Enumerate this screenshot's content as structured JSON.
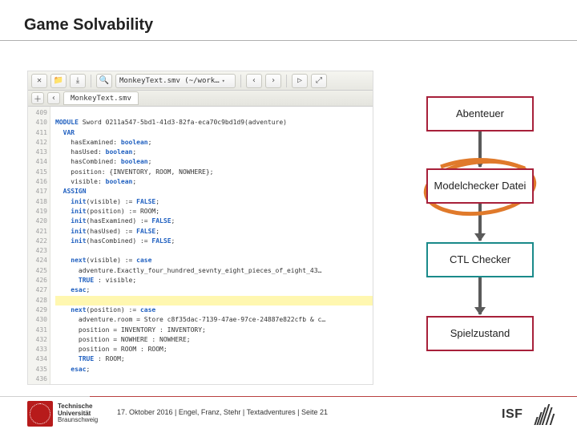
{
  "title": "Game Solvability",
  "editor": {
    "toolbar": {
      "dropdown1": "MonkeyText.smv (~/work…",
      "tab": "MonkeyText.smv"
    },
    "lines_start": 409,
    "lines_end": 436,
    "code": [
      "",
      "MODULE Sword 0211a547-5bd1-41d3-82fa-eca70c9bd1d9(adventure)",
      "  VAR",
      "    hasExamined: boolean;",
      "    hasUsed: boolean;",
      "    hasCombined: boolean;",
      "    position: {INVENTORY, ROOM, NOWHERE};",
      "    visible: boolean;",
      "  ASSIGN",
      "    init(visible) := FALSE;",
      "    init(position) := ROOM;",
      "    init(hasExamined) := FALSE;",
      "    init(hasUsed) := FALSE;",
      "    init(hasCombined) := FALSE;",
      "",
      "    next(visible) := case",
      "      adventure.Exactly_four_hundred_sevnty_eight_pieces_of_eight_43…",
      "      TRUE : visible;",
      "    esac;",
      "",
      "    next(position) := case",
      "      adventure.room = Store c8f35dac-7139-47ae-97ce-24887e822cfb & c…",
      "      position = INVENTORY : INVENTORY;",
      "      position = NOWHERE : NOWHERE;",
      "      position = ROOM : ROOM;",
      "      TRUE : ROOM;",
      "    esac;",
      ""
    ]
  },
  "flow": {
    "box1": "Abenteuer",
    "box2": "Modelchecker Datei",
    "box3": "CTL Checker",
    "box4": "Spielzustand"
  },
  "footer": {
    "text": "17. Oktober 2016 | Engel, Franz, Stehr | Textadventures | Seite 21",
    "tu_line1": "Technische",
    "tu_line2": "Universität",
    "tu_line3": "Braunschweig",
    "isf": "ISF"
  }
}
